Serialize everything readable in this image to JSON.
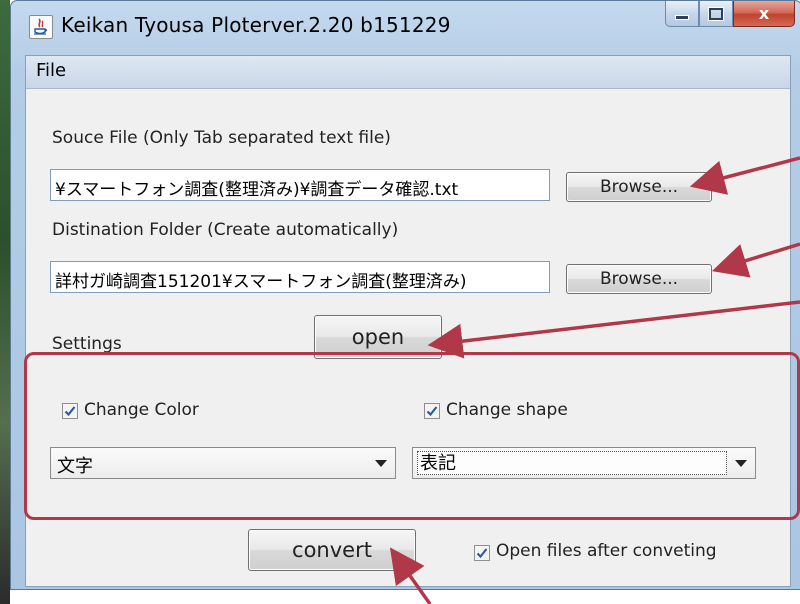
{
  "window": {
    "title": "Keikan Tyousa Ploterver.2.20 b151229",
    "buttons": {
      "minimize": "",
      "maximize": "",
      "close": "x"
    }
  },
  "menu": {
    "file": "File"
  },
  "source": {
    "label": "Souce File (Only Tab separated text file)",
    "value": "¥スマートフォン調査(整理済み)¥調査データ確認.txt",
    "browse": "Browse..."
  },
  "destination": {
    "label": "Distination Folder (Create automatically)",
    "value": "詳村ガ崎調査151201¥スマートフォン調査(整理済み)",
    "browse": "Browse..."
  },
  "open_button": "open",
  "settings": {
    "label": "Settings",
    "change_color": {
      "label": "Change Color",
      "checked": true
    },
    "change_shape": {
      "label": "Change shape",
      "checked": true
    },
    "color_select": "文字",
    "shape_select": "表記"
  },
  "convert_button": "convert",
  "open_after": {
    "label": "Open files after conveting",
    "checked": true
  },
  "colors": {
    "annotation": "#b13848",
    "checkbox_check": "#2c5aa8"
  }
}
